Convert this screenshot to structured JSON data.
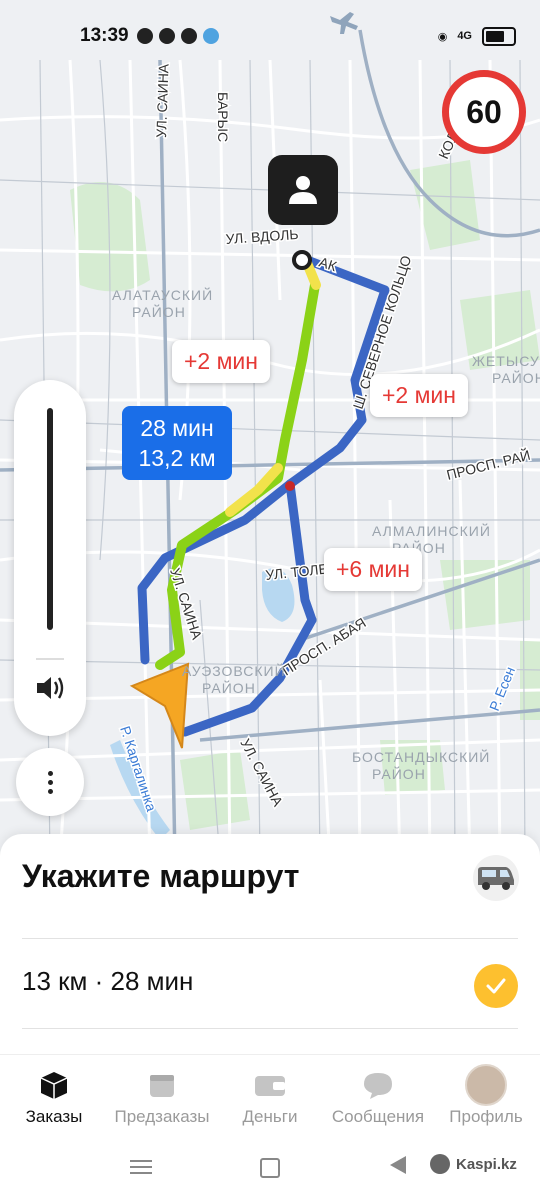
{
  "status": {
    "time": "13:39",
    "network": "4G"
  },
  "map": {
    "speed_limit": "60",
    "streets": [
      {
        "key": "saina_top",
        "text": "УЛ. САИНА"
      },
      {
        "key": "barys",
        "text": "БАРЫС"
      },
      {
        "key": "vdol",
        "text": "УЛ. ВДОЛЬ"
      },
      {
        "key": "ak",
        "text": "АК"
      },
      {
        "key": "severnoe",
        "text": "Ш. СЕВЕРНОЕ КОЛЬЦО"
      },
      {
        "key": "koltso",
        "text": "КОЛЬЦО"
      },
      {
        "key": "rayymbek",
        "text": "ПРОСП. РАЙ"
      },
      {
        "key": "tole",
        "text": "УЛ. ТОЛЕ"
      },
      {
        "key": "abaya",
        "text": "ПРОСП. АБАЯ"
      },
      {
        "key": "saina_mid",
        "text": "УЛ. САИНА"
      },
      {
        "key": "saina_bot",
        "text": "УЛ. САИНА"
      },
      {
        "key": "kargalinka",
        "text": "Р. Каргалинка"
      },
      {
        "key": "esentai",
        "text": "Р. Есен"
      }
    ],
    "districts": [
      {
        "key": "alatau",
        "line1": "АЛАТАУСКИЙ",
        "line2": "РАЙОН"
      },
      {
        "key": "zhetysu",
        "line1": "ЖЕТЫСУСК",
        "line2": "РАЙОН"
      },
      {
        "key": "almaly",
        "line1": "АЛМАЛИНСКИЙ",
        "line2": "РАЙОН"
      },
      {
        "key": "auezov",
        "line1": "АУЭЗОВСКИЙ",
        "line2": "РАЙОН"
      },
      {
        "key": "bostandyk",
        "line1": "БОСТАНДЫКСКИЙ",
        "line2": "РАЙОН"
      }
    ],
    "routes": {
      "main_time": "28 мин",
      "main_distance": "13,2 км",
      "alt1": "+2 мин",
      "alt2": "+2 мин",
      "alt3": "+6 мин"
    }
  },
  "sheet": {
    "title": "Укажите маршрут",
    "summary": "13 км · 28 мин"
  },
  "tabs": [
    {
      "key": "orders",
      "label": "Заказы",
      "active": true
    },
    {
      "key": "preorders",
      "label": "Предзаказы"
    },
    {
      "key": "money",
      "label": "Деньги"
    },
    {
      "key": "messages",
      "label": "Сообщения"
    },
    {
      "key": "profile",
      "label": "Профиль"
    }
  ],
  "watermark": "Kaspi.kz",
  "colors": {
    "route_main": "#8bd217",
    "route_alt": "#3b66c4",
    "accent_blue": "#1a6ee8",
    "alert_red": "#e53935",
    "check_yellow": "#fdc02f"
  }
}
